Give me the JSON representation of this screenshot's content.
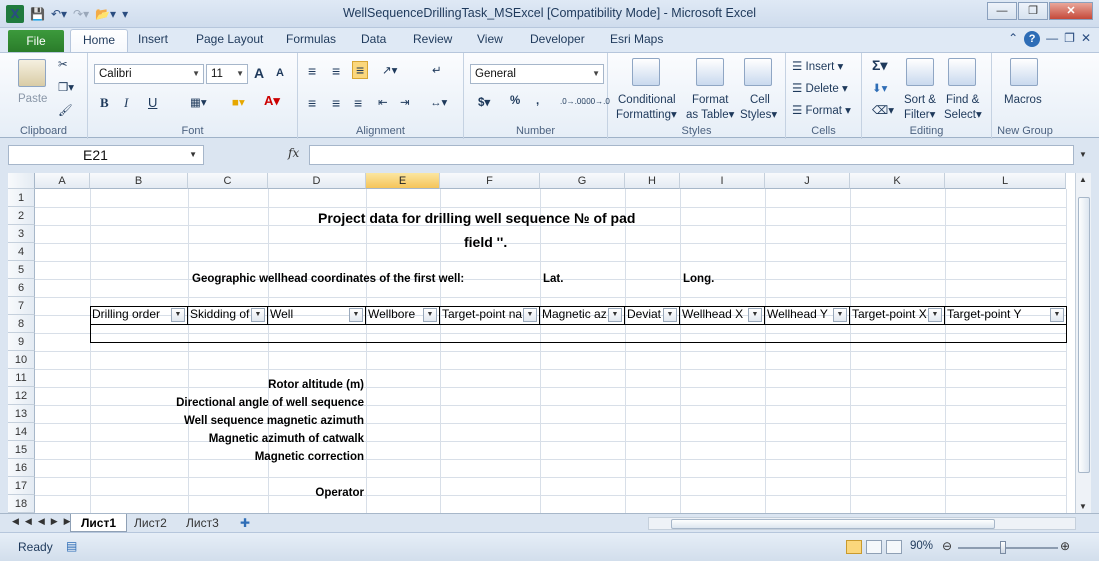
{
  "window": {
    "title": "WellSequenceDrillingTask_MSExcel  [Compatibility Mode] - Microsoft Excel",
    "app_icon": "X"
  },
  "ribbon_tabs": [
    "File",
    "Home",
    "Insert",
    "Page Layout",
    "Formulas",
    "Data",
    "Review",
    "View",
    "Developer",
    "Esri Maps"
  ],
  "ribbon": {
    "clipboard": {
      "label": "Clipboard",
      "paste": "Paste"
    },
    "font": {
      "label": "Font",
      "name": "Calibri",
      "size": "11",
      "bold": "B",
      "italic": "I",
      "underline": "U",
      "grow": "A",
      "shrink": "A"
    },
    "alignment": {
      "label": "Alignment"
    },
    "number": {
      "label": "Number",
      "format": "General",
      "currency": "$",
      "percent": "%",
      "comma": ",",
      "inc": ".0→.00",
      "dec": ".00→.0"
    },
    "styles": {
      "label": "Styles",
      "conditional": "Conditional",
      "conditional2": "Formatting",
      "format_table": "Format",
      "format_table2": "as Table",
      "cell_styles": "Cell",
      "cell_styles2": "Styles"
    },
    "cells": {
      "label": "Cells",
      "insert": "Insert",
      "delete": "Delete",
      "format": "Format"
    },
    "editing": {
      "label": "Editing",
      "sum": "Σ",
      "sort": "Sort &",
      "sort2": "Filter",
      "find": "Find &",
      "find2": "Select"
    },
    "newgroup": {
      "label": "New Group",
      "macros": "Macros"
    }
  },
  "formula_bar": {
    "name_box": "E21",
    "fx": "fx",
    "value": ""
  },
  "columns": [
    "A",
    "B",
    "C",
    "D",
    "E",
    "F",
    "G",
    "H",
    "I",
    "J",
    "K",
    "L"
  ],
  "selected_column": "E",
  "rows": [
    "1",
    "2",
    "3",
    "4",
    "5",
    "6",
    "7",
    "8",
    "9",
    "10",
    "11",
    "12",
    "13",
    "14",
    "15",
    "16",
    "17",
    "18"
  ],
  "sheet": {
    "title_line1": "Project data for drilling well sequence №  of pad",
    "title_line2": "field  ''.",
    "geo_label": "Geographic wellhead coordinates of the first well:",
    "lat": "Lat.",
    "long": "Long.",
    "table_headers": [
      "Drilling order",
      "Skidding of",
      "Well",
      "Wellbore",
      "Target-point na",
      "Magnetic az",
      "Deviat",
      "Wellhead X",
      "Wellhead Y",
      "Target-point X",
      "Target-point Y"
    ],
    "params": [
      "Rotor altitude (m)",
      "Directional angle of well sequence",
      "Well sequence magnetic azimuth",
      "Magnetic azimuth of catwalk",
      "Magnetic correction"
    ],
    "operator": "Operator"
  },
  "sheet_tabs": [
    "Лист1",
    "Лист2",
    "Лист3"
  ],
  "active_sheet": "Лист1",
  "status": {
    "text": "Ready",
    "zoom": "90%"
  }
}
